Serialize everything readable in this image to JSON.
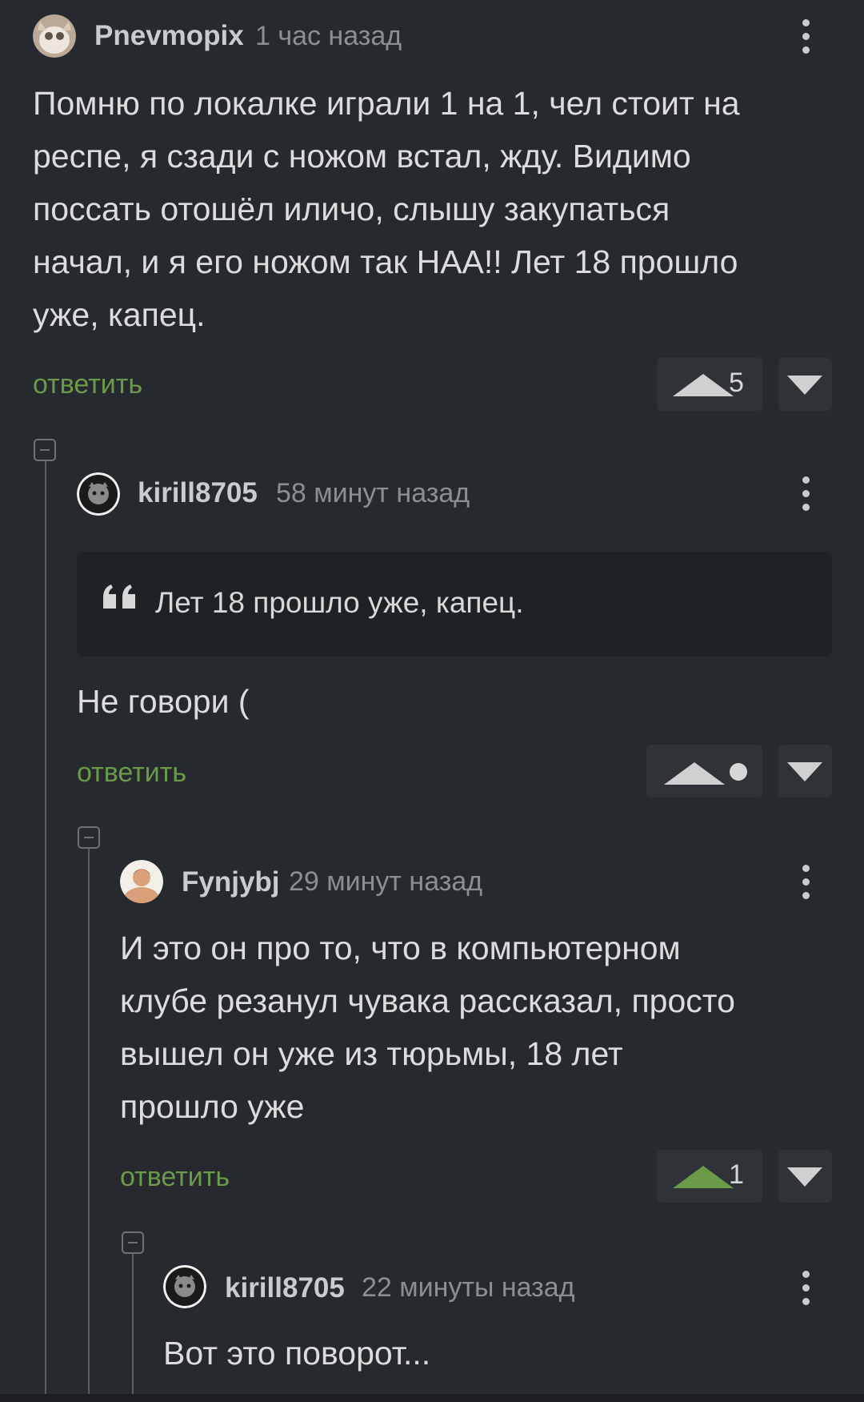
{
  "comments": [
    {
      "username": "Pnevmopix",
      "time": "1 час назад",
      "lines": [
        "Помню по локалке играли 1 на 1, чел стоит на",
        "респе, я сзади с ножом встал, жду. Видимо",
        "поссать отошёл иличо, слышу закупаться",
        "начал, и я его ножом так НАА!! Лет 18 прошло",
        "уже, капец."
      ],
      "reply_label": "ответить",
      "votes": "5",
      "voted_up": false
    },
    {
      "username": "kirill8705",
      "time": "58 минут назад",
      "quote": "Лет 18 прошло уже, капец.",
      "lines": [
        "Не говори ("
      ],
      "reply_label": "ответить",
      "votes": "•",
      "voted_up": false
    },
    {
      "username": "Fynjybj",
      "time": "29 минут назад",
      "lines": [
        "И это он про то, что в компьютерном",
        "клубе резанул чувака рассказал, просто",
        "вышел он уже из тюрьмы, 18 лет",
        "прошло уже"
      ],
      "reply_label": "ответить",
      "votes": "1",
      "voted_up": true
    },
    {
      "username": "kirill8705",
      "time": "22 минуты назад",
      "lines": [
        "Вот это поворот..."
      ]
    }
  ],
  "colors": {
    "background": "#26292d",
    "reply_green": "#6a9a4a",
    "upvote_active": "#6a9a4a"
  }
}
